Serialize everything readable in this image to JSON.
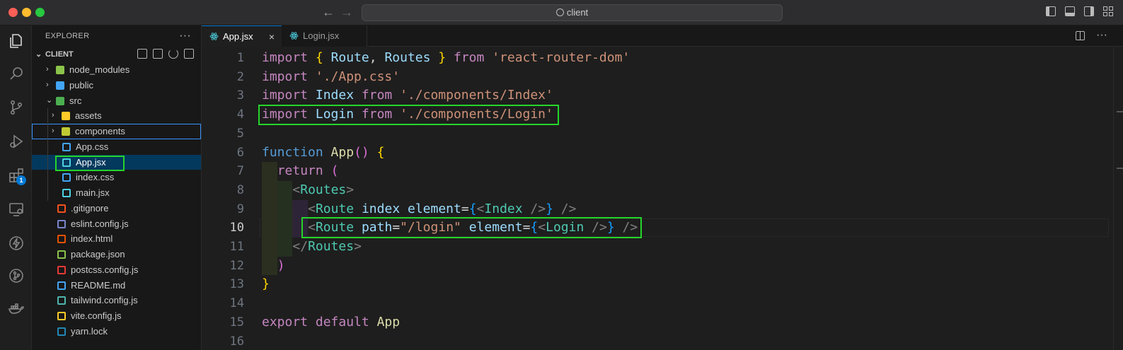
{
  "window": {
    "search_text": "client"
  },
  "activity_bar": {
    "items": [
      "explorer",
      "search",
      "source-control",
      "run-debug",
      "extensions",
      "remote-explorer",
      "thunder",
      "git-graph",
      "docker"
    ],
    "extensions_badge": "1"
  },
  "sidebar": {
    "header": "EXPLORER",
    "more": "···",
    "section": "CLIENT",
    "tree": [
      {
        "label": "node_modules",
        "type": "folder",
        "indent": 0,
        "icon_color": "#8bc34a"
      },
      {
        "label": "public",
        "type": "folder",
        "indent": 0,
        "icon_color": "#42a5f5"
      },
      {
        "label": "src",
        "type": "folder-open",
        "indent": 0,
        "icon_color": "#4caf50"
      },
      {
        "label": "assets",
        "type": "folder",
        "indent": 1,
        "icon_color": "#ffca28"
      },
      {
        "label": "components",
        "type": "folder",
        "indent": 1,
        "icon_color": "#c0ca33"
      },
      {
        "label": "App.css",
        "type": "file",
        "indent": 1,
        "icon_color": "#42a5f5"
      },
      {
        "label": "App.jsx",
        "type": "file",
        "indent": 1,
        "icon_color": "#4dd0e1"
      },
      {
        "label": "index.css",
        "type": "file",
        "indent": 1,
        "icon_color": "#42a5f5"
      },
      {
        "label": "main.jsx",
        "type": "file",
        "indent": 1,
        "icon_color": "#4dd0e1"
      },
      {
        "label": ".gitignore",
        "type": "file",
        "indent": 0,
        "icon_color": "#f4511e"
      },
      {
        "label": "eslint.config.js",
        "type": "file",
        "indent": 0,
        "icon_color": "#7986cb"
      },
      {
        "label": "index.html",
        "type": "file",
        "indent": 0,
        "icon_color": "#e65100"
      },
      {
        "label": "package.json",
        "type": "file",
        "indent": 0,
        "icon_color": "#8bc34a"
      },
      {
        "label": "postcss.config.js",
        "type": "file",
        "indent": 0,
        "icon_color": "#e53935"
      },
      {
        "label": "README.md",
        "type": "file",
        "indent": 0,
        "icon_color": "#42a5f5"
      },
      {
        "label": "tailwind.config.js",
        "type": "file",
        "indent": 0,
        "icon_color": "#4db6ac"
      },
      {
        "label": "vite.config.js",
        "type": "file",
        "indent": 0,
        "icon_color": "#ffca28"
      },
      {
        "label": "yarn.lock",
        "type": "file",
        "indent": 0,
        "icon_color": "#2188b6"
      }
    ]
  },
  "tabs": [
    {
      "label": "App.jsx",
      "active": true,
      "close": "×"
    },
    {
      "label": "Login.jsx",
      "active": false
    }
  ],
  "editor": {
    "current_line": "10",
    "lines": [
      {
        "n": "1"
      },
      {
        "n": "2"
      },
      {
        "n": "3"
      },
      {
        "n": "4"
      },
      {
        "n": "5"
      },
      {
        "n": "6"
      },
      {
        "n": "7"
      },
      {
        "n": "8"
      },
      {
        "n": "9"
      },
      {
        "n": "10"
      },
      {
        "n": "11"
      },
      {
        "n": "12"
      },
      {
        "n": "13"
      },
      {
        "n": "14"
      },
      {
        "n": "15"
      },
      {
        "n": "16"
      }
    ],
    "code": {
      "l1": [
        "import",
        " ",
        "{",
        " ",
        "Route",
        ", ",
        "Routes",
        " ",
        "}",
        " ",
        "from",
        " ",
        "'react-router-dom'"
      ],
      "l2": [
        "import",
        " ",
        "'./App.css'"
      ],
      "l3": [
        "import",
        " ",
        "Index",
        " ",
        "from",
        " ",
        "'./components/Index'"
      ],
      "l4": [
        "import",
        " ",
        "Login",
        " ",
        "from",
        " ",
        "'./components/Login'"
      ],
      "l6": [
        "function",
        " ",
        "App",
        "()",
        " ",
        "{"
      ],
      "l7": [
        "return",
        " ",
        "("
      ],
      "l8": [
        "<",
        "Routes",
        ">"
      ],
      "l9": [
        "<",
        "Route",
        " ",
        "index",
        " ",
        "element",
        "=",
        "{",
        "<",
        "Index",
        " />",
        "}",
        " />"
      ],
      "l10": [
        "<",
        "Route",
        " ",
        "path",
        "=",
        "\"/login\"",
        " ",
        "element",
        "=",
        "{",
        "<",
        "Login",
        " />",
        "}",
        " />"
      ],
      "l11": [
        "</",
        "Routes",
        ">"
      ],
      "l12": [
        ")"
      ],
      "l13": [
        "}"
      ],
      "l15": [
        "export",
        " ",
        "default",
        " ",
        "App"
      ]
    }
  }
}
